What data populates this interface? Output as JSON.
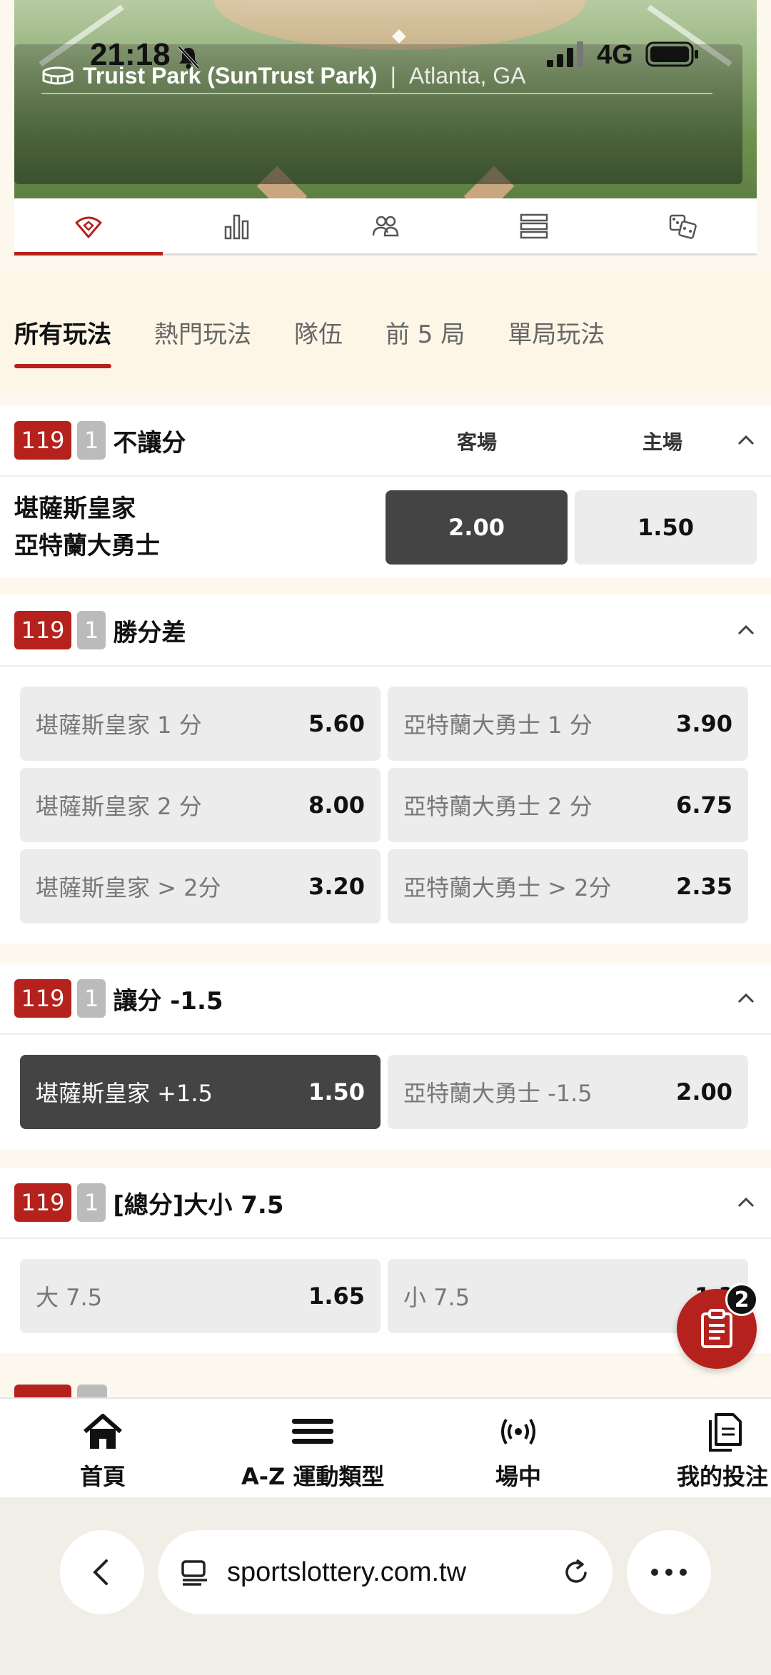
{
  "status_bar": {
    "time": "21:18",
    "network": "4G"
  },
  "venue": {
    "name": "Truist Park (SunTrust Park)",
    "separator": "|",
    "city": "Atlanta, GA"
  },
  "icon_tabs": [
    "field-icon",
    "stats-icon",
    "lineup-icon",
    "list-icon",
    "dice-icon"
  ],
  "bet_tabs": [
    "所有玩法",
    "熱門玩法",
    "隊伍",
    "前 5 局",
    "單局玩法"
  ],
  "markets": {
    "moneyline": {
      "number": "119",
      "leg": "1",
      "title": "不讓分",
      "col_away": "客場",
      "col_home": "主場",
      "team_away": "堪薩斯皇家",
      "team_home": "亞特蘭大勇士",
      "odd_away": "2.00",
      "odd_home": "1.50"
    },
    "margin": {
      "number": "119",
      "leg": "1",
      "title": "勝分差",
      "cells": [
        {
          "label": "堪薩斯皇家 1 分",
          "odd": "5.60"
        },
        {
          "label": "亞特蘭大勇士 1 分",
          "odd": "3.90"
        },
        {
          "label": "堪薩斯皇家 2 分",
          "odd": "8.00"
        },
        {
          "label": "亞特蘭大勇士 2 分",
          "odd": "6.75"
        },
        {
          "label": "堪薩斯皇家 > 2分",
          "odd": "3.20"
        },
        {
          "label": "亞特蘭大勇士 > 2分",
          "odd": "2.35"
        }
      ]
    },
    "handicap": {
      "number": "119",
      "leg": "1",
      "title": "讓分 -1.5",
      "cells": [
        {
          "label": "堪薩斯皇家 +1.5",
          "odd": "1.50"
        },
        {
          "label": "亞特蘭大勇士 -1.5",
          "odd": "2.00"
        }
      ]
    },
    "total": {
      "number": "119",
      "leg": "1",
      "title": "[總分]大小 7.5",
      "cells": [
        {
          "label": "大 7.5",
          "odd": "1.65"
        },
        {
          "label": "小 7.5",
          "odd": "1.?"
        }
      ]
    }
  },
  "betslip": {
    "count": "2"
  },
  "bottom_nav": {
    "home": "首頁",
    "sports": "A-Z 運動類型",
    "live": "場中",
    "mybets": "我的投注"
  },
  "browser": {
    "url": "sportslottery.com.tw"
  },
  "colors": {
    "accent": "#b5211c",
    "selected": "#444444",
    "odd_bg": "#ececec"
  }
}
